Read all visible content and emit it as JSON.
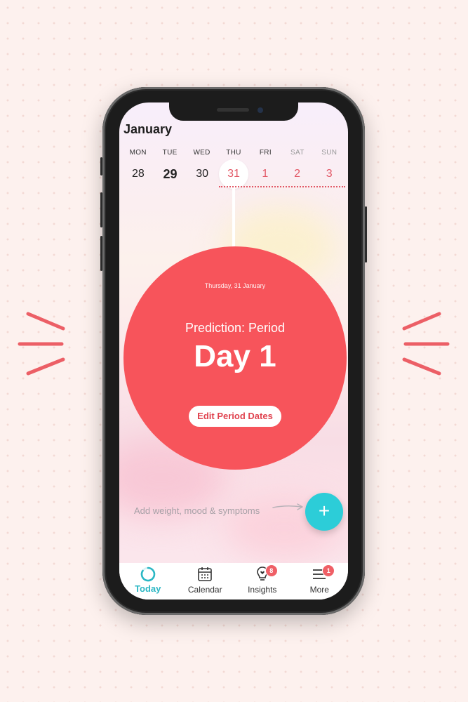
{
  "calendar": {
    "month": "January",
    "weekdays": [
      "MON",
      "TUE",
      "WED",
      "THU",
      "FRI",
      "SAT",
      "SUN"
    ],
    "dates": [
      "28",
      "29",
      "30",
      "31",
      "1",
      "2",
      "3"
    ]
  },
  "prediction": {
    "date_label": "Thursday, 31 January",
    "title": "Prediction: Period",
    "day": "Day 1",
    "edit_button": "Edit Period Dates"
  },
  "log_prompt": "Add weight, mood & symptoms",
  "fab_icon": "plus-icon",
  "nav": {
    "items": [
      {
        "label": "Today",
        "icon": "today-ring-icon"
      },
      {
        "label": "Calendar",
        "icon": "calendar-icon"
      },
      {
        "label": "Insights",
        "icon": "lightbulb-heart-icon",
        "badge": "8"
      },
      {
        "label": "More",
        "icon": "menu-icon",
        "badge": "1"
      }
    ]
  },
  "colors": {
    "accent_red": "#f7545b",
    "accent_teal": "#2ccdd8",
    "background": "#fdf1ee"
  }
}
